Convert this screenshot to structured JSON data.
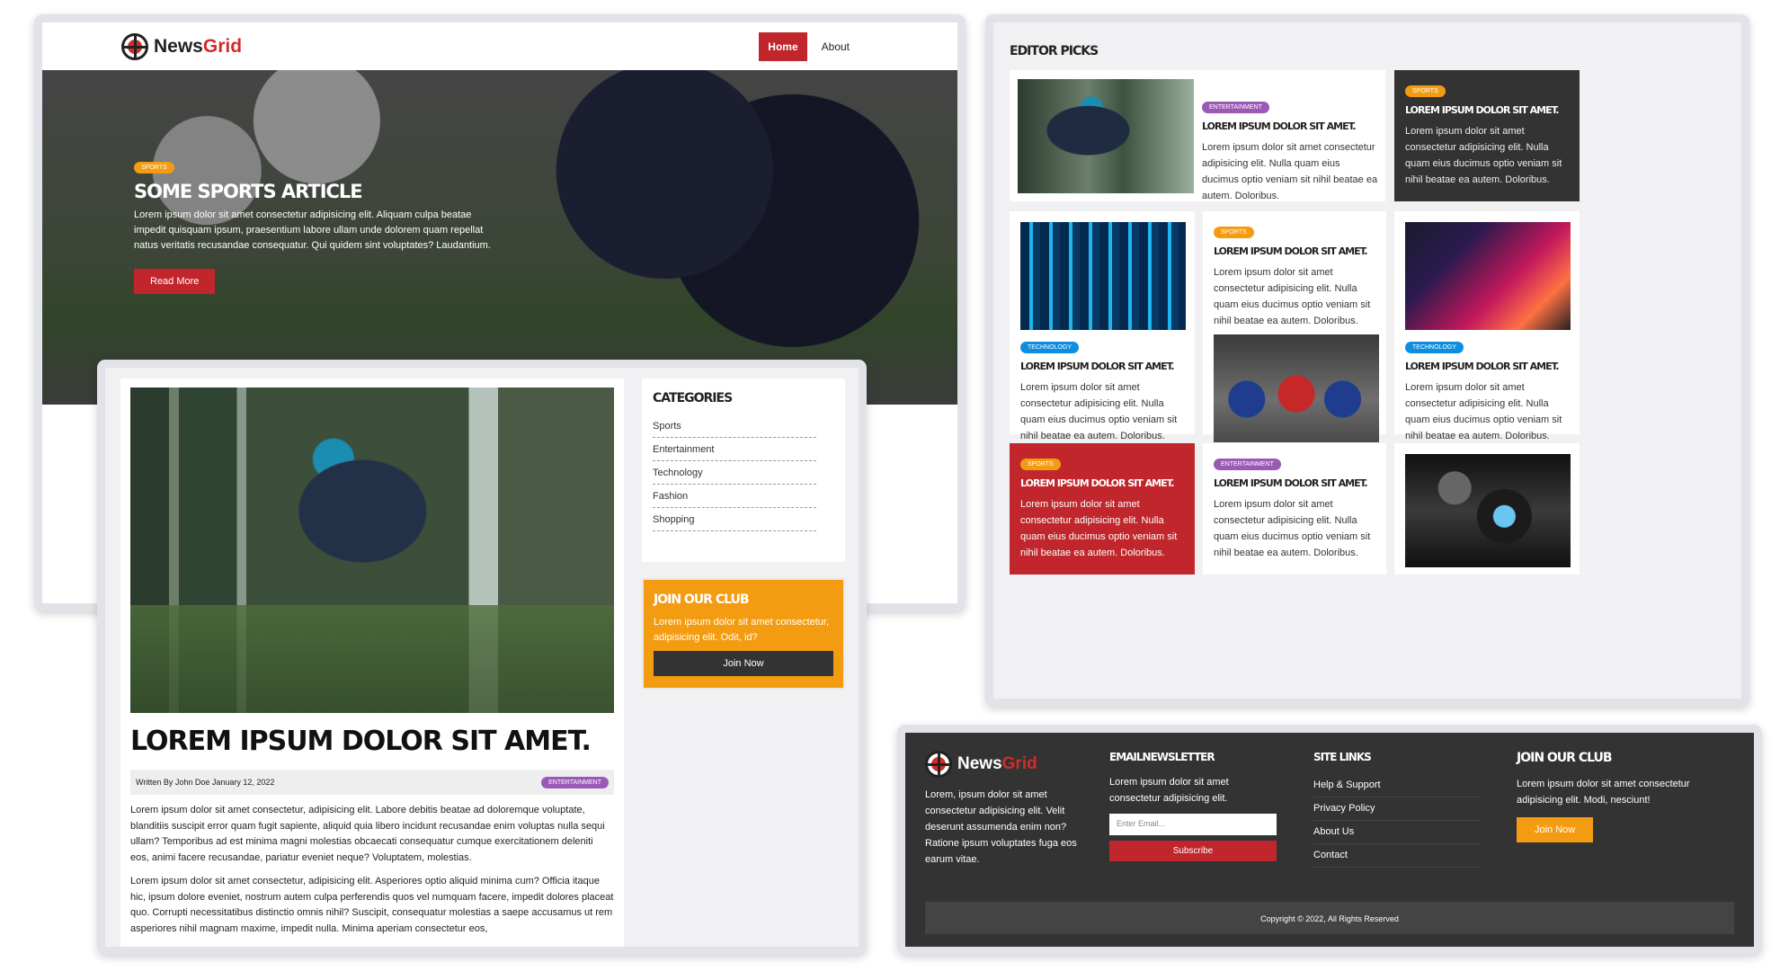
{
  "s1": {
    "brand_news": "News",
    "brand_grid": "Grid",
    "nav": {
      "home": "Home",
      "about": "About"
    },
    "hero": {
      "badge": "Sports",
      "title": "Some Sports Article",
      "text": "Lorem ipsum dolor sit amet consectetur adipisicing elit. Aliquam culpa beatae impedit quisquam ipsum, praesentium labore ullam unde dolorem quam repellat natus veritatis recusandae consequatur. Qui quidem sint voluptates? Laudantium.",
      "button": "Read More"
    }
  },
  "s2": {
    "title": "Lorem ipsum dolor sit amet.",
    "meta": "Written By John Doe January 12, 2022",
    "badge": "Entertainment",
    "para1": "Lorem ipsum dolor sit amet consectetur, adipisicing elit. Labore debitis beatae ad doloremque voluptate, blanditiis suscipit error quam fugit sapiente, aliquid quia libero incidunt recusandae enim voluptas nulla sequi ullam? Temporibus ad est minima magni molestias obcaecati consequatur cumque exercitationem deleniti eos, animi facere recusandae, pariatur eveniet neque? Voluptatem, molestias.",
    "para2": "Lorem ipsum dolor sit amet consectetur, adipisicing elit. Asperiores optio aliquid minima cum? Officia itaque hic, ipsum dolore eveniet, nostrum autem culpa perferendis quos vel numquam facere, impedit dolores placeat quo. Corrupti necessitatibus distinctio omnis nihil? Suscipit, consequatur molestias a saepe accusamus ut rem asperiores nihil magnam maxime, impedit nulla. Minima aperiam consectetur eos,",
    "categories_title": "Categories",
    "categories": [
      "Sports",
      "Entertainment",
      "Technology",
      "Fashion",
      "Shopping"
    ],
    "club_title": "Join Our Club",
    "club_text": "Lorem ipsum dolor sit amet consectetur, adipisicing elit. Odit, id?",
    "club_button": "Join Now"
  },
  "s3": {
    "title": "Editor Picks",
    "card_title": "Lorem ipsum dolor sit amet.",
    "card_text": "Lorem ipsum dolor sit amet consectetur adipisicing elit. Nulla quam eius ducimus optio veniam sit nihil beatae ea autem. Doloribus.",
    "badges": {
      "sports": "Sports",
      "ent": "Entertainment",
      "tech": "Technology"
    }
  },
  "s4": {
    "brand_news": "News",
    "brand_grid": "Grid",
    "about_text": "Lorem, ipsum dolor sit amet consectetur adipisicing elit. Velit deserunt assumenda enim non? Ratione ipsum voluptates fuga eos earum vitae.",
    "newsletter_title": "Emailnewsletter",
    "newsletter_text": "Lorem ipsum dolor sit amet consectetur adipisicing elit.",
    "email_placeholder": "Enter Email...",
    "subscribe": "Subscribe",
    "links_title": "Site Links",
    "links": [
      "Help & Support",
      "Privacy Policy",
      "About Us",
      "Contact"
    ],
    "club_title": "Join Our Club",
    "club_text": "Lorem ipsum dolor sit amet consectetur adipisicing elit. Modi, nesciunt!",
    "club_button": "Join Now",
    "copyright": "Copyright © 2022, All Rights Reserved"
  },
  "colors": {
    "brand_red": "#c0262c",
    "orange": "#f39c12",
    "purple": "#9b59b6",
    "blue": "#0d8fe0",
    "dark": "#333333"
  }
}
